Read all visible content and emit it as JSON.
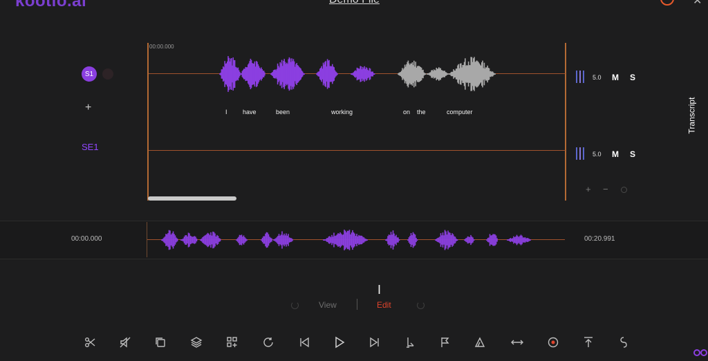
{
  "app": {
    "logo_text": "kootio.ai",
    "file_title": "Demo File"
  },
  "tracks": [
    {
      "avatar": "S1",
      "volume": "5.0",
      "mute": "M",
      "solo": "S"
    },
    {
      "volume": "5.0",
      "mute": "M",
      "solo": "S"
    }
  ],
  "speaker_label": "SE1",
  "editor": {
    "time_start": "00:00.000",
    "words": [
      "I",
      "have",
      "been",
      "working",
      "on",
      "the",
      "computer"
    ]
  },
  "overview": {
    "start_time": "00:00.000",
    "end_time": "00:20.991"
  },
  "mode": {
    "view": "View",
    "edit": "Edit",
    "active": "Edit"
  },
  "transcript_tab": "Transcript",
  "colors": {
    "accent": "#8b3fe0",
    "waveform_active": "#8b3fe0",
    "waveform_inactive": "#a8a8a8",
    "timeline_line": "#a0522d",
    "edit_active": "#e0442c",
    "volume_bars": "#5a66cc"
  },
  "toolbar_icons": [
    "cut-icon",
    "mute-icon",
    "copy-icon",
    "layers-icon",
    "add-block-icon",
    "loop-icon",
    "skip-back-icon",
    "play-icon",
    "skip-forward-icon",
    "split-icon",
    "flag-icon",
    "fade-icon",
    "stretch-icon",
    "record-icon",
    "export-icon",
    "link-icon"
  ]
}
